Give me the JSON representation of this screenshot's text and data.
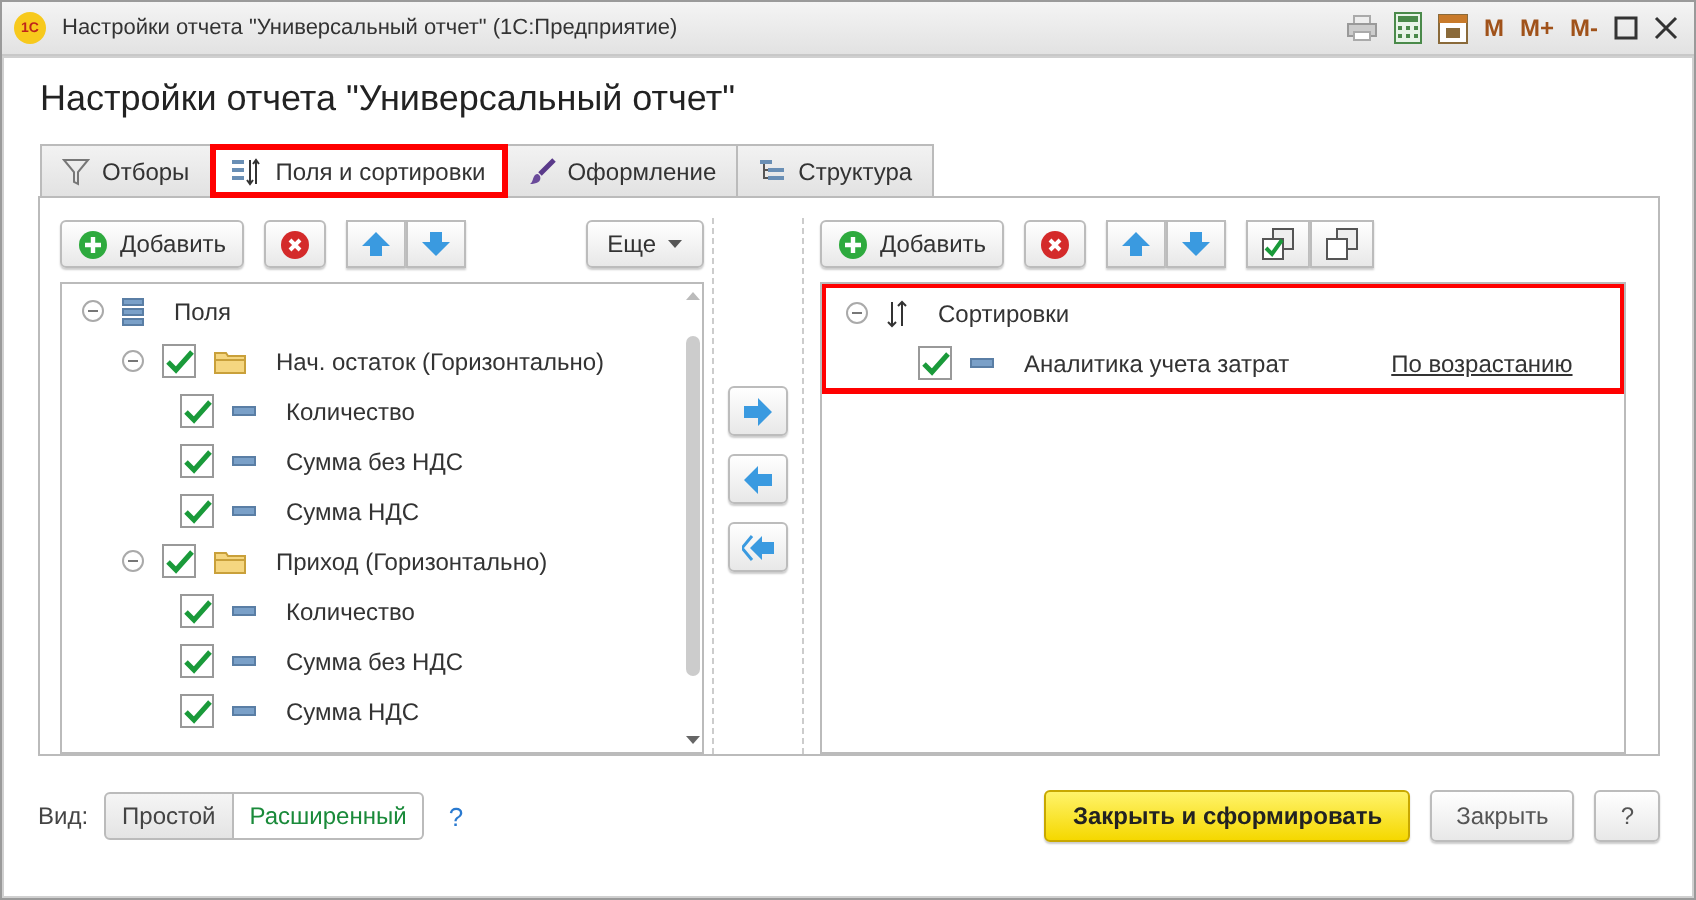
{
  "window": {
    "logo": "1С",
    "title": "Настройки отчета \"Универсальный отчет\"  (1С:Предприятие)",
    "memory_buttons": [
      "M",
      "M+",
      "M-"
    ]
  },
  "header": "Настройки отчета \"Универсальный отчет\"",
  "tabs": [
    {
      "label": "Отборы",
      "selected": false,
      "highlighted": false
    },
    {
      "label": "Поля и сортировки",
      "selected": true,
      "highlighted": true
    },
    {
      "label": "Оформление",
      "selected": false,
      "highlighted": false
    },
    {
      "label": "Структура",
      "selected": false,
      "highlighted": false
    }
  ],
  "fields_panel": {
    "add": "Добавить",
    "more": "Еще",
    "tree": [
      {
        "label": "Поля",
        "kind": "root",
        "expanded": true,
        "children": [
          {
            "label": "Нач. остаток (Горизонтально)",
            "kind": "group",
            "checked": true,
            "expanded": true,
            "children": [
              {
                "label": "Количество",
                "kind": "field",
                "checked": true
              },
              {
                "label": "Сумма без НДС",
                "kind": "field",
                "checked": true
              },
              {
                "label": "Сумма НДС",
                "kind": "field",
                "checked": true
              }
            ]
          },
          {
            "label": "Приход (Горизонтально)",
            "kind": "group",
            "checked": true,
            "expanded": true,
            "children": [
              {
                "label": "Количество",
                "kind": "field",
                "checked": true
              },
              {
                "label": "Сумма без НДС",
                "kind": "field",
                "checked": true
              },
              {
                "label": "Сумма НДС",
                "kind": "field",
                "checked": true
              }
            ]
          }
        ]
      }
    ]
  },
  "sort_panel": {
    "add": "Добавить",
    "highlighted": true,
    "tree": [
      {
        "label": "Сортировки",
        "kind": "sortroot",
        "expanded": true,
        "children": [
          {
            "label": "Аналитика учета затрат",
            "kind": "field",
            "checked": true,
            "direction": "По возрастанию"
          }
        ]
      }
    ]
  },
  "view": {
    "label": "Вид:",
    "options": [
      {
        "label": "Простой",
        "selected": false
      },
      {
        "label": "Расширенный",
        "selected": true
      }
    ],
    "help": "?"
  },
  "buttons": [
    {
      "label": "Закрыть и сформировать",
      "kind": "primary"
    },
    {
      "label": "Закрыть",
      "kind": "default"
    },
    {
      "label": "?",
      "kind": "default"
    }
  ]
}
